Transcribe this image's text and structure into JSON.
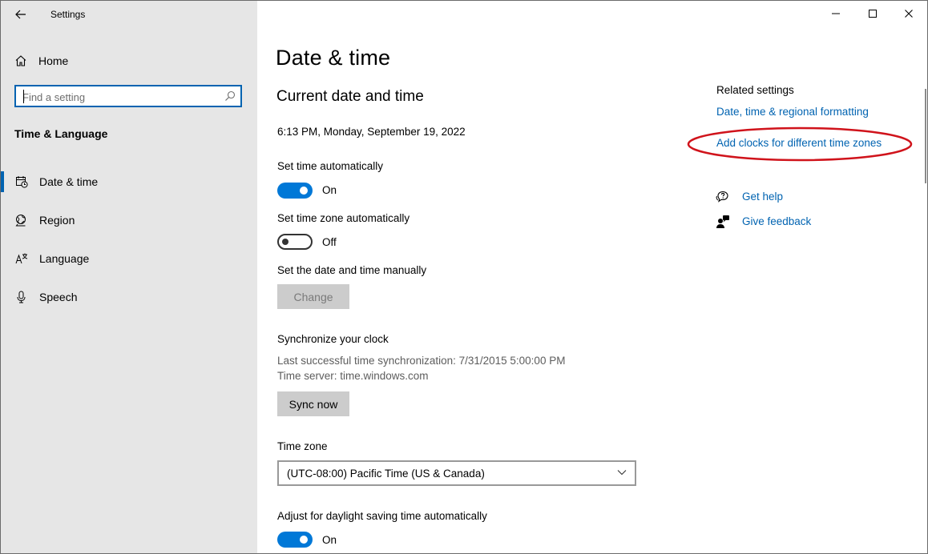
{
  "window": {
    "title": "Settings",
    "controls": [
      "minimize-icon",
      "maximize-icon",
      "close-icon"
    ]
  },
  "sidebar": {
    "home_label": "Home",
    "search_placeholder": "Find a setting",
    "section_title": "Time & Language",
    "items": [
      {
        "label": "Date & time",
        "icon": "calendar-clock-icon",
        "active": true
      },
      {
        "label": "Region",
        "icon": "globe-icon",
        "active": false
      },
      {
        "label": "Language",
        "icon": "language-icon",
        "active": false
      },
      {
        "label": "Speech",
        "icon": "microphone-icon",
        "active": false
      }
    ]
  },
  "main": {
    "page_title": "Date & time",
    "section_title": "Current date and time",
    "current_datetime": "6:13 PM, Monday, September 19, 2022",
    "set_time_auto": {
      "label": "Set time automatically",
      "state": "On",
      "on": true
    },
    "set_timezone_auto": {
      "label": "Set time zone automatically",
      "state": "Off",
      "on": false
    },
    "manual": {
      "label": "Set the date and time manually",
      "button": "Change"
    },
    "sync": {
      "title": "Synchronize your clock",
      "last_sync": "Last successful time synchronization: 7/31/2015 5:00:00 PM",
      "server": "Time server: time.windows.com",
      "button": "Sync now"
    },
    "timezone": {
      "label": "Time zone",
      "value": "(UTC-08:00) Pacific Time (US & Canada)"
    },
    "dst": {
      "label": "Adjust for daylight saving time automatically",
      "state": "On",
      "on": true
    }
  },
  "related": {
    "title": "Related settings",
    "links": [
      "Date, time & regional formatting",
      "Add clocks for different time zones"
    ],
    "help": "Get help",
    "feedback": "Give feedback"
  },
  "colors": {
    "accent": "#0078d7",
    "link": "#0063b1",
    "sidebar_bg": "#e6e6e6",
    "annotation": "#d0131b"
  }
}
